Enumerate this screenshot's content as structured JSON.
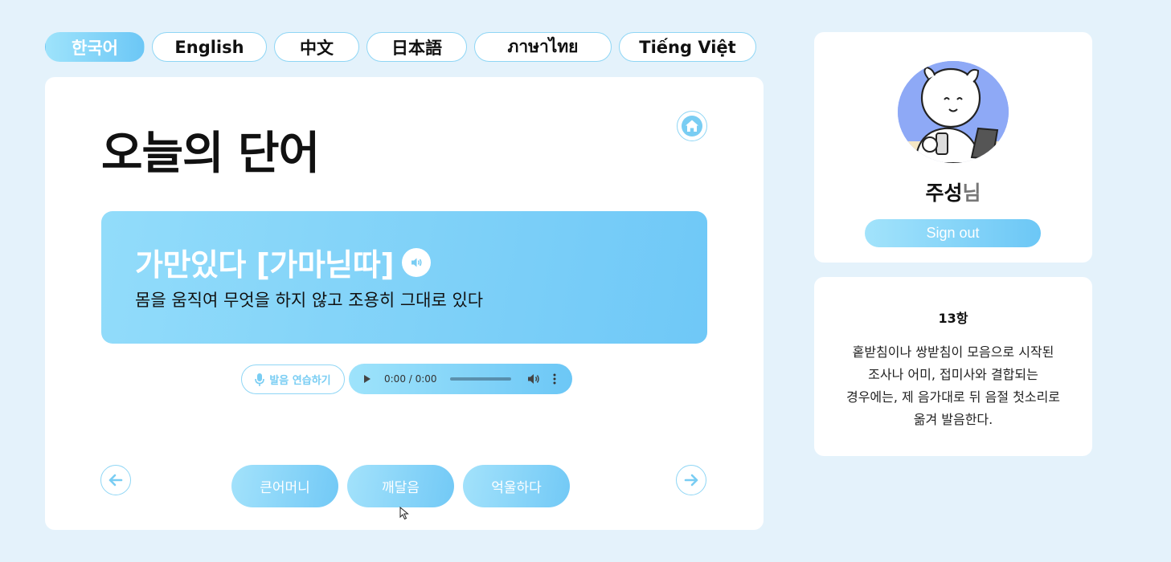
{
  "languages": [
    {
      "label": "한국어",
      "active": true
    },
    {
      "label": "English",
      "active": false
    },
    {
      "label": "中文",
      "active": false
    },
    {
      "label": "日本語",
      "active": false
    },
    {
      "label": "ภาษาไทย",
      "active": false
    },
    {
      "label": "Tiếng Việt",
      "active": false
    }
  ],
  "main": {
    "title": "오늘의 단어",
    "word": "가만있다 [가마닏따]",
    "meaning": "몸을 움직여 무엇을 하지 않고 조용히 그대로 있다",
    "practice_label": "발음 연습하기",
    "audio_time": "0:00 / 0:00",
    "related_words": [
      "큰어머니",
      "깨달음",
      "억울하다"
    ]
  },
  "profile": {
    "name": "주성",
    "suffix": "님",
    "signout_label": "Sign out"
  },
  "rule": {
    "title": "13항",
    "text": "홑받침이나 쌍받침이 모음으로 시작된 조사나 어미, 접미사와 결합되는 경우에는, 제 음가대로 뒤 음절 첫소리로 옮겨 발음한다."
  },
  "colors": {
    "accent": "#79cdf3",
    "background": "#e4f2fb",
    "avatar_bg": "#8ea9f6"
  },
  "icons": [
    "home-icon",
    "speaker-icon",
    "microphone-icon",
    "play-icon",
    "volume-icon",
    "more-icon",
    "arrow-left-icon",
    "arrow-right-icon"
  ]
}
